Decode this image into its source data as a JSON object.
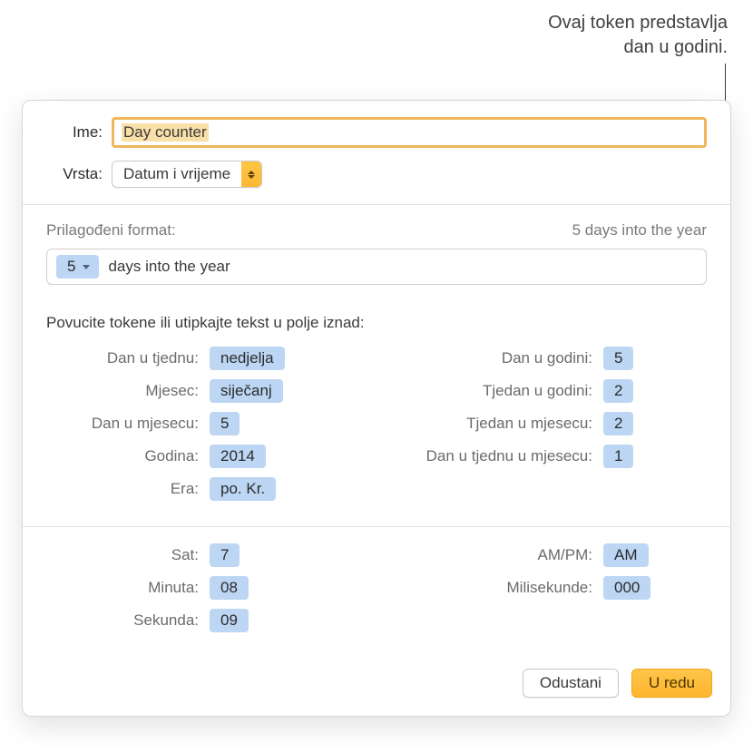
{
  "callout": {
    "line1": "Ovaj token predstavlja",
    "line2": "dan u godini."
  },
  "fields": {
    "name_label": "Ime:",
    "name_value": "Day counter",
    "type_label": "Vrsta:",
    "type_value": "Datum i vrijeme"
  },
  "format": {
    "label": "Prilagođeni format:",
    "preview": "5 days into the year",
    "token_value": "5",
    "suffix_text": "days into the year"
  },
  "hint": "Povucite tokene ili utipkajte tekst u polje iznad:",
  "tokens": {
    "left": [
      {
        "label": "Dan u tjednu:",
        "value": "nedjelja"
      },
      {
        "label": "Mjesec:",
        "value": "siječanj"
      },
      {
        "label": "Dan u mjesecu:",
        "value": "5"
      },
      {
        "label": "Godina:",
        "value": "2014"
      },
      {
        "label": "Era:",
        "value": "po. Kr."
      }
    ],
    "right": [
      {
        "label": "Dan u godini:",
        "value": "5"
      },
      {
        "label": "Tjedan u godini:",
        "value": "2"
      },
      {
        "label": "Tjedan u mjesecu:",
        "value": "2"
      },
      {
        "label": "Dan u tjednu u mjesecu:",
        "value": "1"
      }
    ]
  },
  "time_tokens": {
    "left": [
      {
        "label": "Sat:",
        "value": "7"
      },
      {
        "label": "Minuta:",
        "value": "08"
      },
      {
        "label": "Sekunda:",
        "value": "09"
      }
    ],
    "right": [
      {
        "label": "AM/PM:",
        "value": "AM"
      },
      {
        "label": "Milisekunde:",
        "value": "000"
      }
    ]
  },
  "buttons": {
    "cancel": "Odustani",
    "ok": "U redu"
  }
}
